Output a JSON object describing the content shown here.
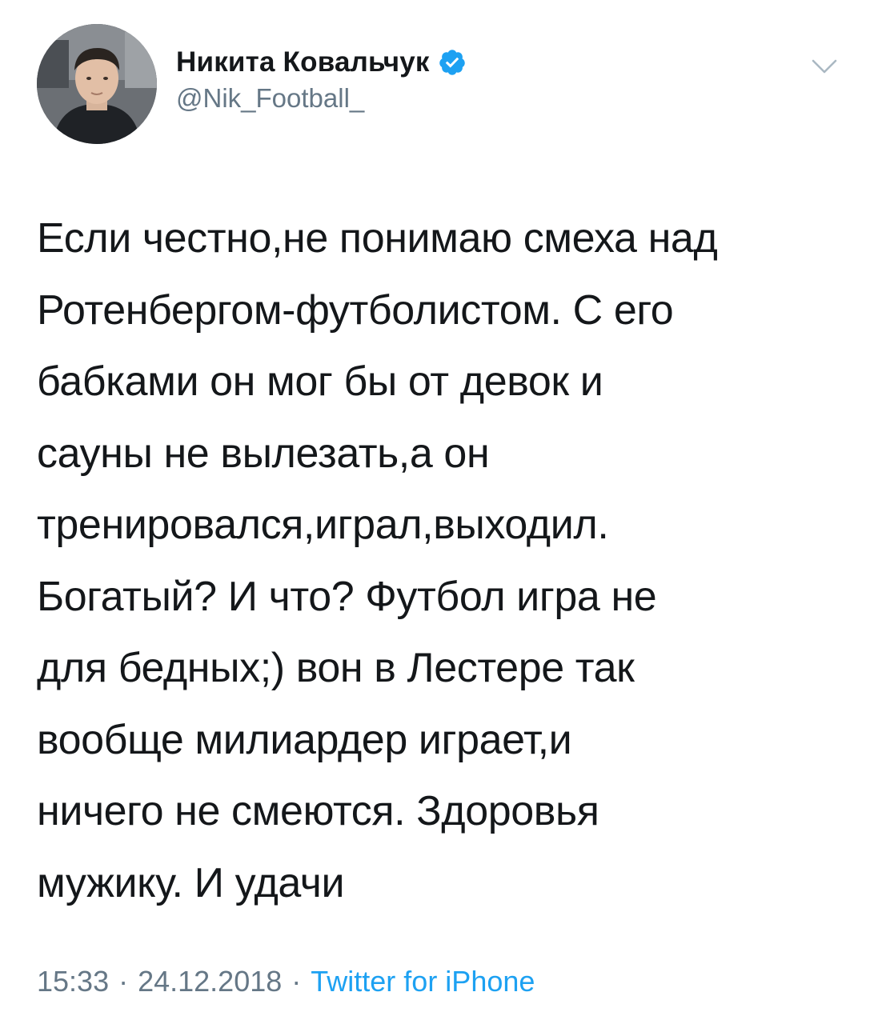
{
  "author": {
    "display_name": "Никита Ковальчук",
    "handle": "@Nik_Football_",
    "verified_icon": "verified-badge-icon"
  },
  "menu_icon": "chevron-down-icon",
  "tweet": {
    "lines": [
      "Если честно,не понимаю смеха над",
      "Ротенбергом-футболистом. С его",
      "бабками он мог бы от девок и",
      "сауны не вылезать,а он",
      "тренировался,играл,выходил.",
      "Богатый? И что? Футбол игра не",
      "для бедных;) вон в Лестере так",
      "вообще милиардер играет,и",
      "ничего не смеются. Здоровья",
      "мужику. И удачи"
    ]
  },
  "meta": {
    "time": "15:33",
    "separator": "·",
    "date": "24.12.2018",
    "source": "Twitter for iPhone"
  },
  "colors": {
    "text": "#14171a",
    "secondary": "#657786",
    "accent": "#1da1f2"
  }
}
